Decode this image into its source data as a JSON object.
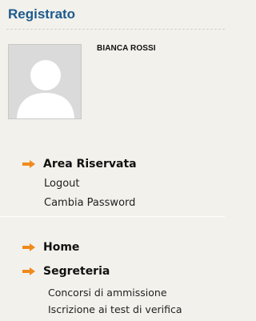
{
  "header": {
    "title": "Registrato"
  },
  "user": {
    "name": "BIANCA ROSSI",
    "avatar_icon": "user-placeholder-icon"
  },
  "reserved_section": {
    "label": "Area Riservata",
    "links": [
      "Logout",
      "Cambia Password"
    ]
  },
  "nav": {
    "home_label": "Home",
    "secretariat_label": "Segreteria",
    "secretariat_links": [
      "Concorsi di ammissione",
      "Iscrizione ai test di verifica"
    ]
  },
  "colors": {
    "header_text": "#1e5a8c",
    "arrow": "#f08a1c",
    "background": "#f2f1ec"
  }
}
